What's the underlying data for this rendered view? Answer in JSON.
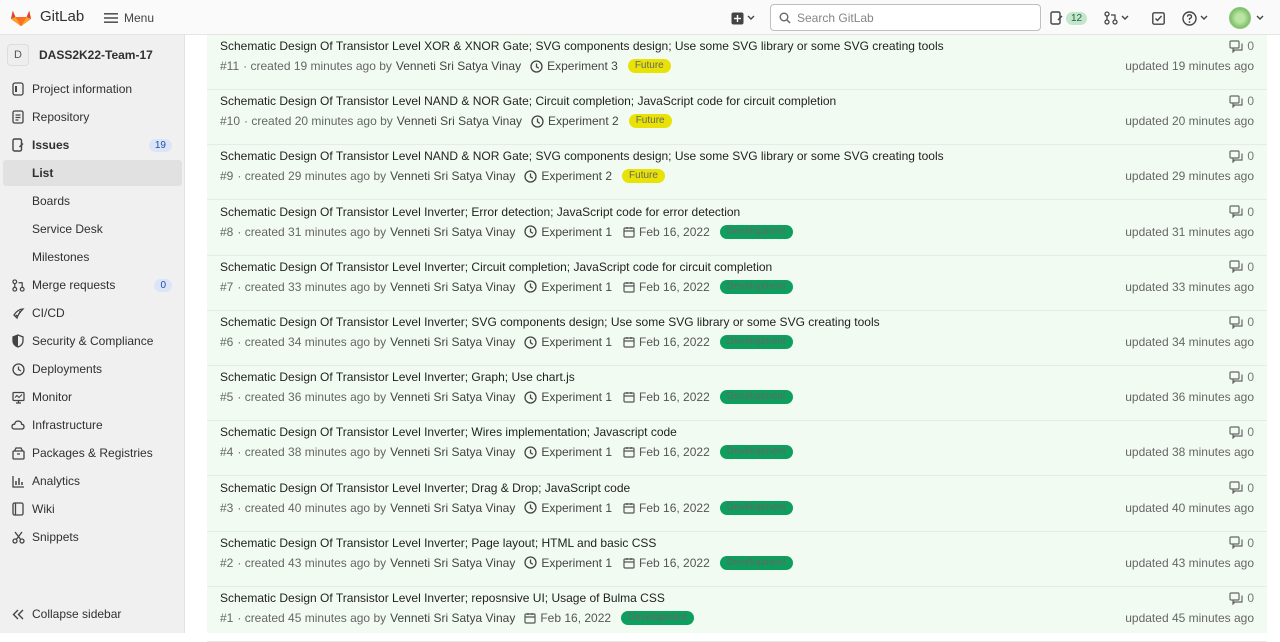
{
  "header": {
    "brand": "GitLab",
    "menu_label": "Menu",
    "search_placeholder": "Search GitLab",
    "issues_count": "12"
  },
  "sidebar": {
    "project_initial": "D",
    "project_name": "DASS2K22-Team-17",
    "items": [
      {
        "label": "Project information",
        "icon": "info-icon"
      },
      {
        "label": "Repository",
        "icon": "document-icon"
      },
      {
        "label": "Issues",
        "icon": "issues-icon",
        "badge": "19"
      },
      {
        "label": "List"
      },
      {
        "label": "Boards"
      },
      {
        "label": "Service Desk"
      },
      {
        "label": "Milestones"
      },
      {
        "label": "Merge requests",
        "icon": "merge-request-icon",
        "badge": "0"
      },
      {
        "label": "CI/CD",
        "icon": "rocket-icon"
      },
      {
        "label": "Security & Compliance",
        "icon": "shield-icon"
      },
      {
        "label": "Deployments",
        "icon": "deployments-icon"
      },
      {
        "label": "Monitor",
        "icon": "monitor-icon"
      },
      {
        "label": "Infrastructure",
        "icon": "cloud-icon"
      },
      {
        "label": "Packages & Registries",
        "icon": "package-icon"
      },
      {
        "label": "Analytics",
        "icon": "chart-icon"
      },
      {
        "label": "Wiki",
        "icon": "book-icon"
      },
      {
        "label": "Snippets",
        "icon": "scissors-icon"
      }
    ],
    "collapse_label": "Collapse sidebar"
  },
  "issues": [
    {
      "title": "Schematic Design Of Transistor Level XOR & XNOR Gate; SVG components design; Use some SVG library or some SVG creating tools",
      "ref": "#11",
      "created": "· created 19 minutes ago by",
      "author": "Venneti Sri Satya Vinay",
      "milestone": "Experiment 3",
      "due": "",
      "label": "Future",
      "label_color": "#e9e206",
      "comments": "0",
      "updated": "updated 19 minutes ago"
    },
    {
      "title": "Schematic Design Of Transistor Level NAND & NOR Gate; Circuit completion; JavaScript code for circuit completion",
      "ref": "#10",
      "created": "· created 20 minutes ago by",
      "author": "Venneti Sri Satya Vinay",
      "milestone": "Experiment 2",
      "due": "",
      "label": "Future",
      "label_color": "#e9e206",
      "comments": "0",
      "updated": "updated 20 minutes ago"
    },
    {
      "title": "Schematic Design Of Transistor Level NAND & NOR Gate; SVG components design; Use some SVG library or some SVG creating tools",
      "ref": "#9",
      "created": "· created 29 minutes ago by",
      "author": "Venneti Sri Satya Vinay",
      "milestone": "Experiment 2",
      "due": "",
      "label": "Future",
      "label_color": "#e9e206",
      "comments": "0",
      "updated": "updated 29 minutes ago"
    },
    {
      "title": "Schematic Design Of Transistor Level Inverter; Error detection; JavaScript code for error detection",
      "ref": "#8",
      "created": "· created 31 minutes ago by",
      "author": "Venneti Sri Satya Vinay",
      "milestone": "Experiment 1",
      "due": "Feb 16, 2022",
      "label": "Development",
      "label_color": "#0e9f5e",
      "comments": "0",
      "updated": "updated 31 minutes ago"
    },
    {
      "title": "Schematic Design Of Transistor Level Inverter; Circuit completion; JavaScript code for circuit completion",
      "ref": "#7",
      "created": "· created 33 minutes ago by",
      "author": "Venneti Sri Satya Vinay",
      "milestone": "Experiment 1",
      "due": "Feb 16, 2022",
      "label": "Development",
      "label_color": "#0e9f5e",
      "comments": "0",
      "updated": "updated 33 minutes ago"
    },
    {
      "title": "Schematic Design Of Transistor Level Inverter; SVG components design; Use some SVG library or some SVG creating tools",
      "ref": "#6",
      "created": "· created 34 minutes ago by",
      "author": "Venneti Sri Satya Vinay",
      "milestone": "Experiment 1",
      "due": "Feb 16, 2022",
      "label": "Development",
      "label_color": "#0e9f5e",
      "comments": "0",
      "updated": "updated 34 minutes ago"
    },
    {
      "title": "Schematic Design Of Transistor Level Inverter; Graph; Use chart.js",
      "ref": "#5",
      "created": "· created 36 minutes ago by",
      "author": "Venneti Sri Satya Vinay",
      "milestone": "Experiment 1",
      "due": "Feb 16, 2022",
      "label": "Development",
      "label_color": "#0e9f5e",
      "comments": "0",
      "updated": "updated 36 minutes ago"
    },
    {
      "title": "Schematic Design Of Transistor Level Inverter; Wires implementation; Javascript code",
      "ref": "#4",
      "created": "· created 38 minutes ago by",
      "author": "Venneti Sri Satya Vinay",
      "milestone": "Experiment 1",
      "due": "Feb 16, 2022",
      "label": "Development",
      "label_color": "#0e9f5e",
      "comments": "0",
      "updated": "updated 38 minutes ago"
    },
    {
      "title": "Schematic Design Of Transistor Level Inverter; Drag & Drop; JavaScript code",
      "ref": "#3",
      "created": "· created 40 minutes ago by",
      "author": "Venneti Sri Satya Vinay",
      "milestone": "Experiment 1",
      "due": "Feb 16, 2022",
      "label": "Development",
      "label_color": "#0e9f5e",
      "comments": "0",
      "updated": "updated 40 minutes ago"
    },
    {
      "title": "Schematic Design Of Transistor Level Inverter; Page layout; HTML and basic CSS",
      "ref": "#2",
      "created": "· created 43 minutes ago by",
      "author": "Venneti Sri Satya Vinay",
      "milestone": "Experiment 1",
      "due": "Feb 16, 2022",
      "label": "Development",
      "label_color": "#0e9f5e",
      "comments": "0",
      "updated": "updated 43 minutes ago"
    },
    {
      "title": "Schematic Design Of Transistor Level Inverter; reposnsive UI; Usage of Bulma CSS",
      "ref": "#1",
      "created": "· created 45 minutes ago by",
      "author": "Venneti Sri Satya Vinay",
      "milestone": "",
      "due": "Feb 16, 2022",
      "label": "Development",
      "label_color": "#0e9f5e",
      "comments": "0",
      "updated": "updated 45 minutes ago"
    }
  ]
}
